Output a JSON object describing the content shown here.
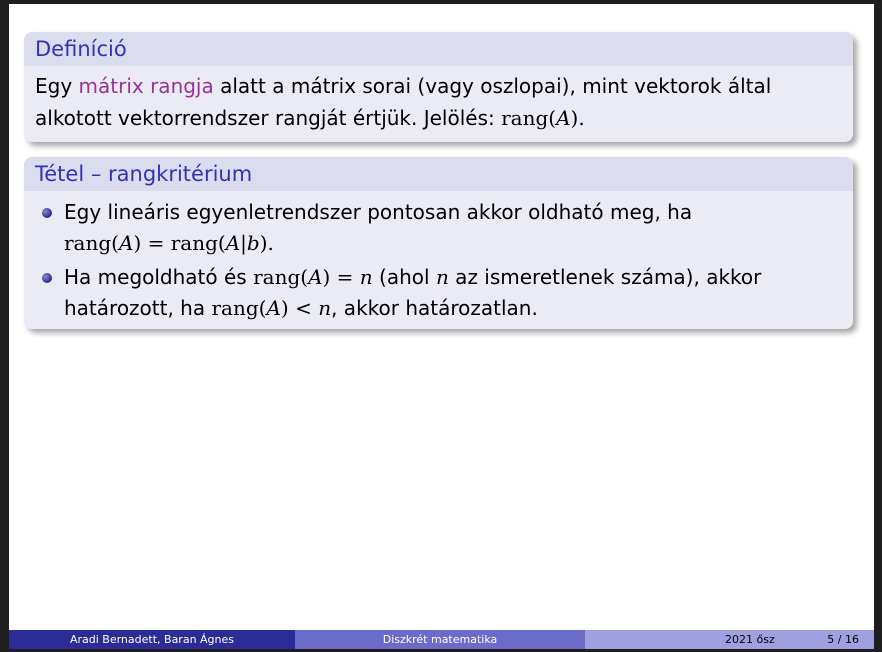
{
  "definition": {
    "title": "Definíció",
    "text_before": "Egy ",
    "highlight": "mátrix rangja",
    "text_after": " alatt a mátrix sorai (vagy oszlopai), mint vektorok által alkotott vektorrendszer rangját értjük. Jelölés: ",
    "notation_op": "rang(",
    "notation_var": "A",
    "notation_close": ")."
  },
  "theorem": {
    "title": "Tétel – rangkritérium",
    "item1": {
      "text": "Egy lineáris egyenletrendszer pontosan akkor oldható meg, ha",
      "math_a": "rang(",
      "var_a": "A",
      "math_b": ") = rang(",
      "var_b": "A",
      "bar": "|",
      "var_c": "b",
      "math_c": ")."
    },
    "item2": {
      "t1": "Ha megoldható és ",
      "m1": "rang(",
      "v1": "A",
      "m2": ") = ",
      "v2": "n",
      "t2": " (ahol ",
      "v3": "n",
      "t3": " az ismeretlenek száma), akkor határozott, ha ",
      "m3": "rang(",
      "v4": "A",
      "m4": ") < ",
      "v5": "n",
      "t4": ", akkor határozatlan."
    }
  },
  "footer": {
    "authors": "Aradi Bernadett, Baran Ágnes",
    "course": "Diszkrét matematika",
    "date": "2021 ősz",
    "page": "5 / 16"
  },
  "colors": {
    "accent": "#3333b2",
    "highlight": "#993399",
    "footer_dark": "#2c2c96",
    "footer_mid": "#6b6bc9",
    "footer_light": "#a0a0e0"
  }
}
